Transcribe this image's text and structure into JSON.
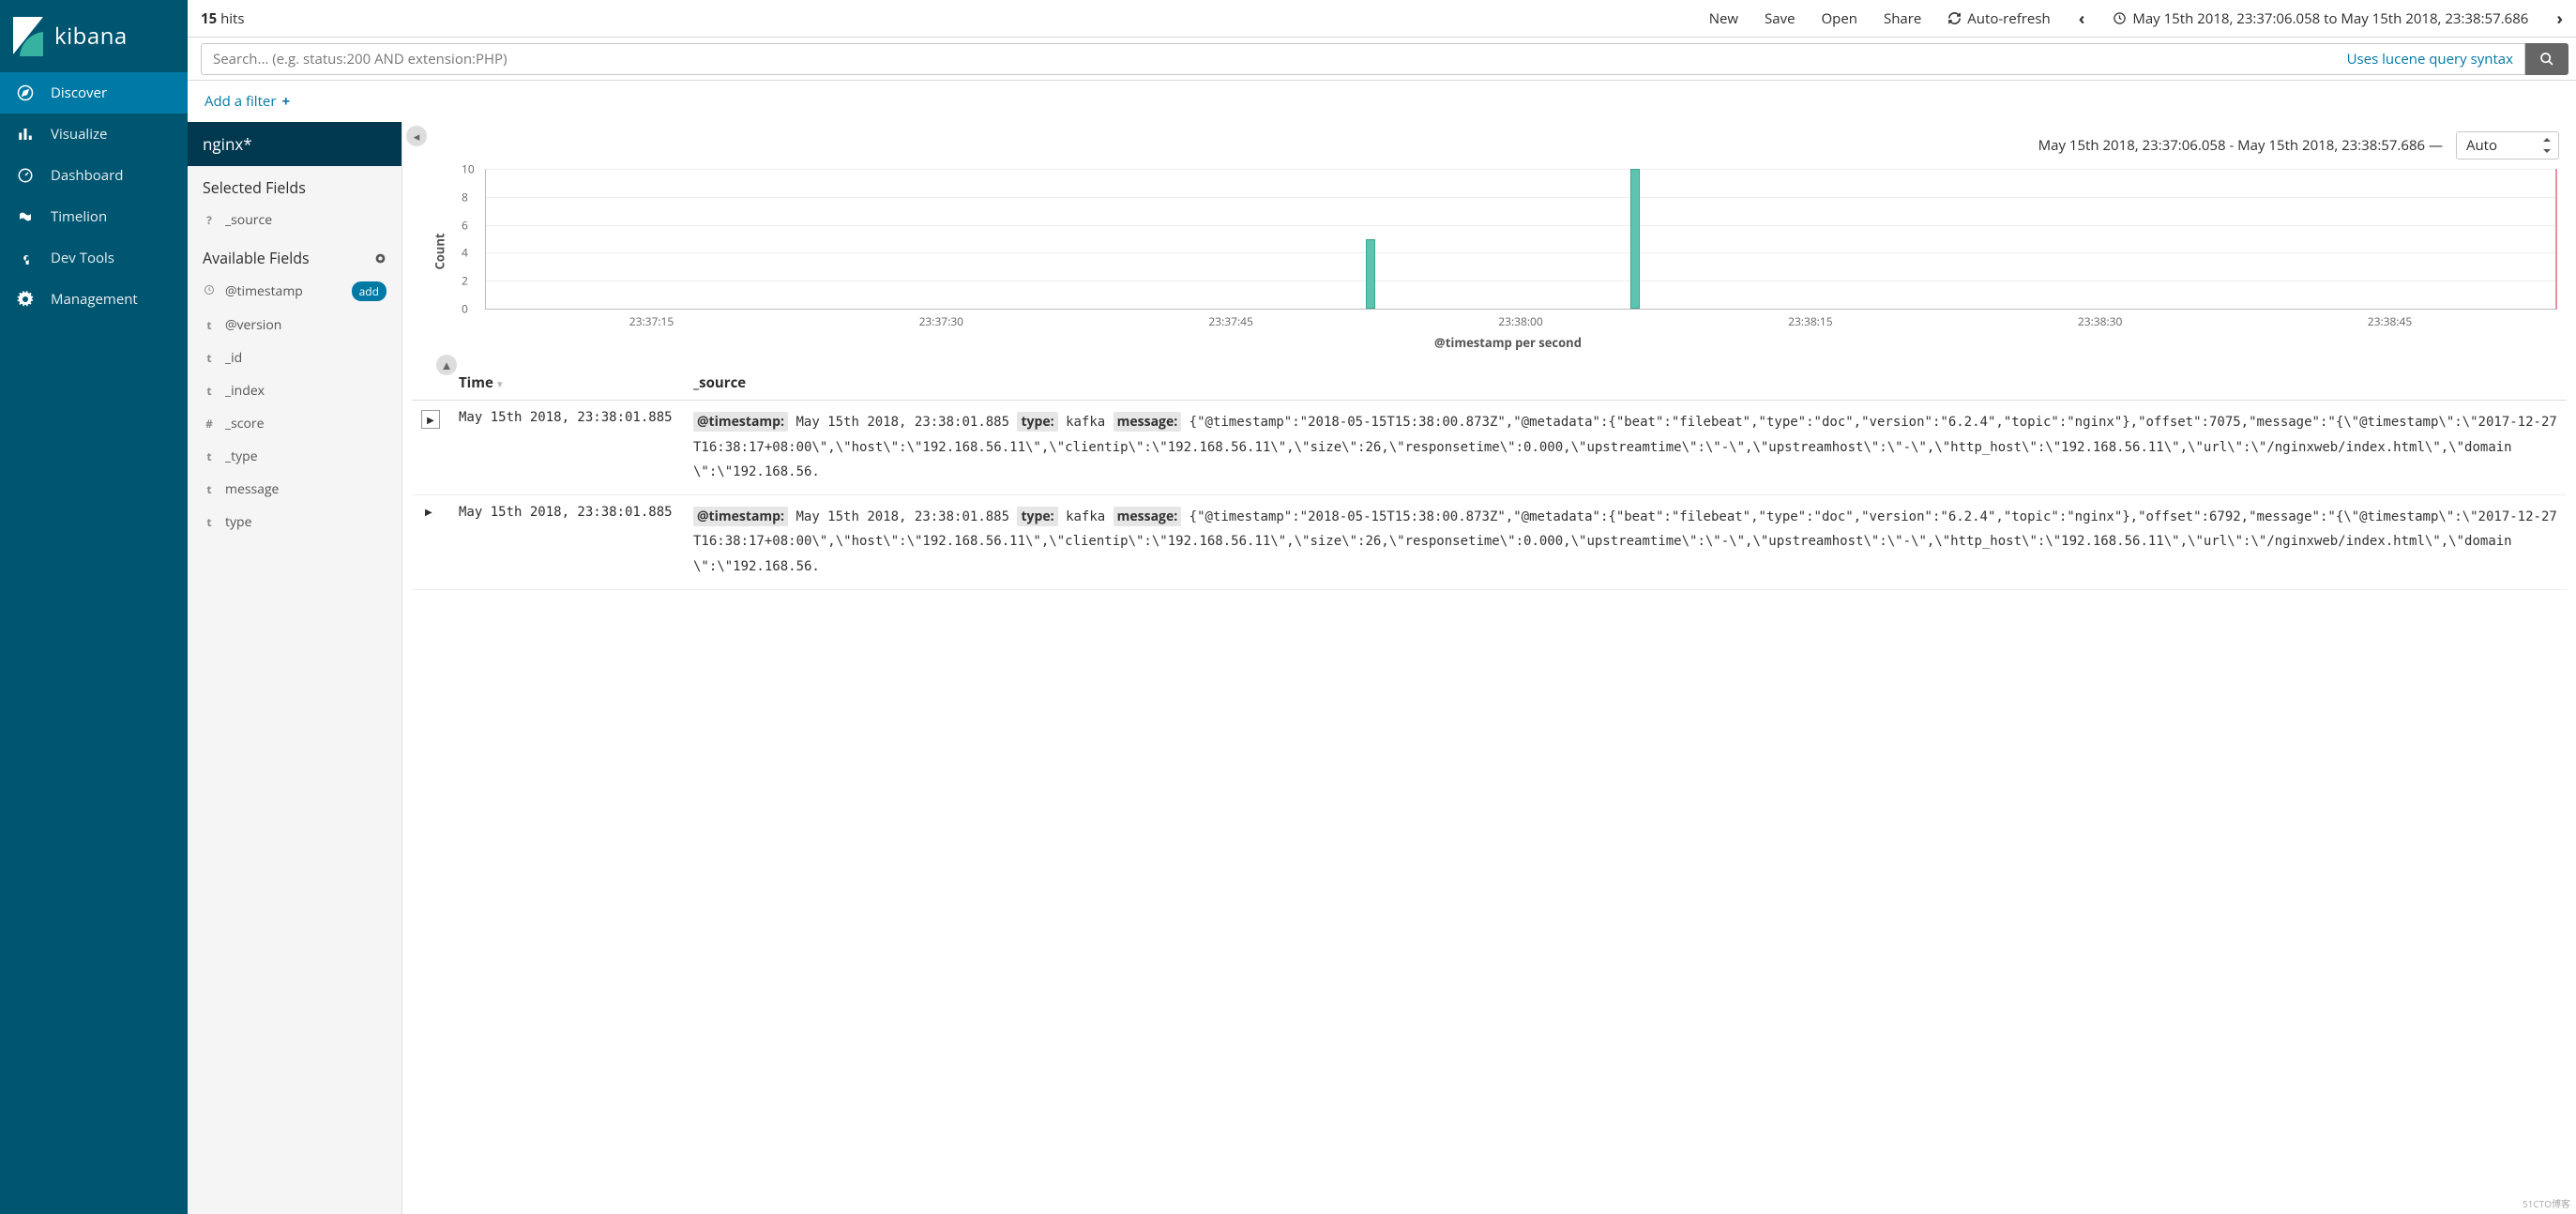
{
  "brand": {
    "name": "kibana"
  },
  "nav": {
    "items": [
      {
        "label": "Discover"
      },
      {
        "label": "Visualize"
      },
      {
        "label": "Dashboard"
      },
      {
        "label": "Timelion"
      },
      {
        "label": "Dev Tools"
      },
      {
        "label": "Management"
      }
    ]
  },
  "topbar": {
    "hits_count": "15",
    "hits_label": "hits",
    "new": "New",
    "save": "Save",
    "open": "Open",
    "share": "Share",
    "autorefresh": "Auto-refresh",
    "timerange": "May 15th 2018, 23:37:06.058 to May 15th 2018, 23:38:57.686"
  },
  "search": {
    "placeholder": "Search... (e.g. status:200 AND extension:PHP)",
    "hint": "Uses lucene query syntax"
  },
  "filter": {
    "add": "Add a filter"
  },
  "sidebar": {
    "index_pattern": "nginx*",
    "selected_header": "Selected Fields",
    "selected": [
      {
        "type": "?",
        "name": "_source"
      }
    ],
    "available_header": "Available Fields",
    "available": [
      {
        "type": "clock",
        "name": "@timestamp",
        "add": "add"
      },
      {
        "type": "t",
        "name": "@version"
      },
      {
        "type": "t",
        "name": "_id"
      },
      {
        "type": "t",
        "name": "_index"
      },
      {
        "type": "#",
        "name": "_score"
      },
      {
        "type": "t",
        "name": "_type"
      },
      {
        "type": "t",
        "name": "message"
      },
      {
        "type": "t",
        "name": "type"
      }
    ]
  },
  "histogram": {
    "title": "May 15th 2018, 23:37:06.058 - May 15th 2018, 23:38:57.686 —",
    "interval": "Auto",
    "ylabel": "Count",
    "xlabel": "@timestamp per second"
  },
  "chart_data": {
    "type": "bar",
    "categories": [
      "23:37:15",
      "23:37:30",
      "23:37:45",
      "23:38:00",
      "23:38:15",
      "23:38:30",
      "23:38:45"
    ],
    "bars": [
      {
        "x_pct": 42.5,
        "value": 5
      },
      {
        "x_pct": 55.3,
        "value": 10
      }
    ],
    "yticks": [
      2,
      4,
      6,
      8,
      10
    ],
    "ymax": 10,
    "title": "May 15th 2018, 23:37:06.058 - May 15th 2018, 23:38:57.686",
    "xlabel": "@timestamp per second",
    "ylabel": "Count"
  },
  "table": {
    "time_header": "Time",
    "source_header": "_source",
    "rows": [
      {
        "time": "May 15th 2018, 23:38:01.885",
        "fields": {
          "timestamp_label": "@timestamp:",
          "timestamp": "May 15th 2018, 23:38:01.885",
          "type_label": "type:",
          "type": "kafka",
          "message_label": "message:"
        },
        "message": "{\"@timestamp\":\"2018-05-15T15:38:00.873Z\",\"@metadata\":{\"beat\":\"filebeat\",\"type\":\"doc\",\"version\":\"6.2.4\",\"topic\":\"nginx\"},\"offset\":7075,\"message\":\"{\\\"@timestamp\\\":\\\"2017-12-27T16:38:17+08:00\\\",\\\"host\\\":\\\"192.168.56.11\\\",\\\"clientip\\\":\\\"192.168.56.11\\\",\\\"size\\\":26,\\\"responsetime\\\":0.000,\\\"upstreamtime\\\":\\\"-\\\",\\\"upstreamhost\\\":\\\"-\\\",\\\"http_host\\\":\\\"192.168.56.11\\\",\\\"url\\\":\\\"/nginxweb/index.html\\\",\\\"domain\\\":\\\"192.168.56."
      },
      {
        "time": "May 15th 2018, 23:38:01.885",
        "fields": {
          "timestamp_label": "@timestamp:",
          "timestamp": "May 15th 2018, 23:38:01.885",
          "type_label": "type:",
          "type": "kafka",
          "message_label": "message:"
        },
        "message": "{\"@timestamp\":\"2018-05-15T15:38:00.873Z\",\"@metadata\":{\"beat\":\"filebeat\",\"type\":\"doc\",\"version\":\"6.2.4\",\"topic\":\"nginx\"},\"offset\":6792,\"message\":\"{\\\"@timestamp\\\":\\\"2017-12-27T16:38:17+08:00\\\",\\\"host\\\":\\\"192.168.56.11\\\",\\\"clientip\\\":\\\"192.168.56.11\\\",\\\"size\\\":26,\\\"responsetime\\\":0.000,\\\"upstreamtime\\\":\\\"-\\\",\\\"upstreamhost\\\":\\\"-\\\",\\\"http_host\\\":\\\"192.168.56.11\\\",\\\"url\\\":\\\"/nginxweb/index.html\\\",\\\"domain\\\":\\\"192.168.56."
      }
    ]
  },
  "watermark": "51CTO博客"
}
